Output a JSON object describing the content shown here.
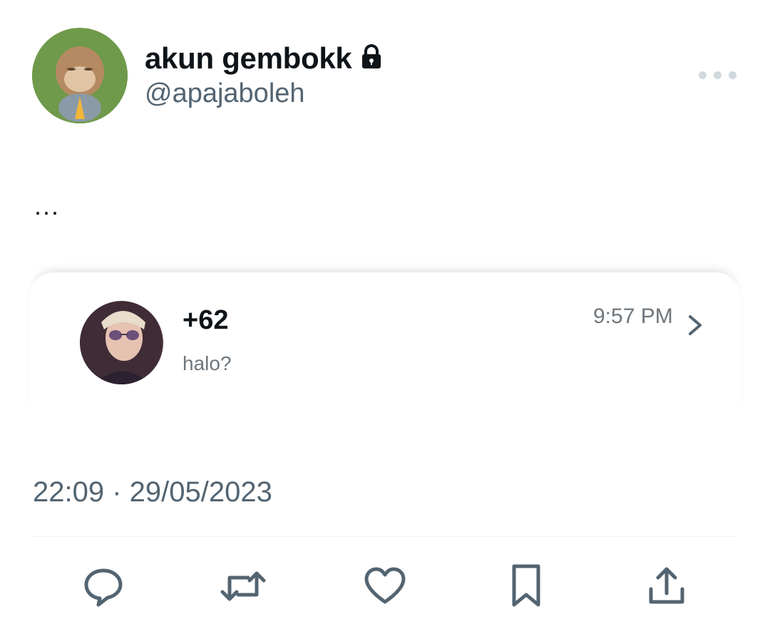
{
  "author": {
    "display_name": "akun gembokk",
    "handle": "@apajaboleh",
    "locked_icon": "lock-icon"
  },
  "tweet": {
    "text": "...",
    "timestamp": "22:09 · 29/05/2023"
  },
  "message_card": {
    "sender": "+62",
    "preview": "halo?",
    "time": "9:57 PM"
  },
  "actions": {
    "reply_icon": "reply-icon",
    "retweet_icon": "retweet-icon",
    "like_icon": "heart-icon",
    "bookmark_icon": "bookmark-icon",
    "share_icon": "share-icon"
  },
  "colors": {
    "text_primary": "#0f1419",
    "text_secondary": "#536471",
    "icon": "#536471",
    "divider": "#eff3f4"
  }
}
